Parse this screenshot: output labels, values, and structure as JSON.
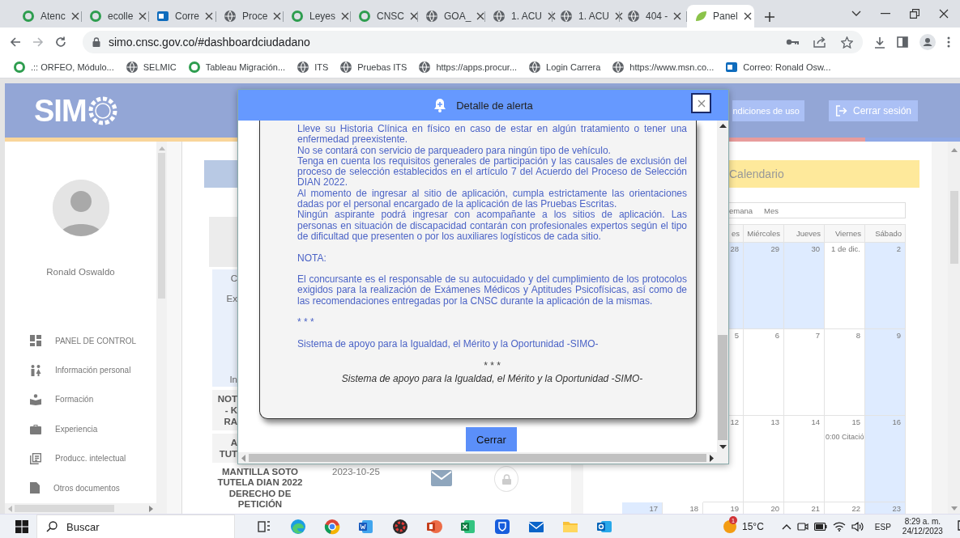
{
  "browser": {
    "tabs": [
      {
        "label": "Atenc",
        "kind": "ring",
        "selected": false
      },
      {
        "label": "ecolle",
        "kind": "ring",
        "selected": false
      },
      {
        "label": "Corre",
        "kind": "mail",
        "selected": false
      },
      {
        "label": "Proce",
        "kind": "globe",
        "selected": false
      },
      {
        "label": "Leyes",
        "kind": "ring",
        "selected": false
      },
      {
        "label": "CNSC",
        "kind": "ring",
        "selected": false
      },
      {
        "label": "GOA_",
        "kind": "globe",
        "selected": false
      },
      {
        "label": "1. ACU",
        "kind": "globe",
        "selected": false
      },
      {
        "label": "1. ACU",
        "kind": "globe",
        "selected": false
      },
      {
        "label": "404 -",
        "kind": "globe",
        "selected": false
      },
      {
        "label": "Panel",
        "kind": "leaf",
        "selected": true
      }
    ],
    "address": "simo.cnsc.gov.co/#dashboardciudadano",
    "bookmarks": [
      {
        "label": ".:: ORFEO, Módulo...",
        "kind": "ring"
      },
      {
        "label": "SELMIC",
        "kind": "globe"
      },
      {
        "label": "Tableau Migración...",
        "kind": "ring"
      },
      {
        "label": "ITS",
        "kind": "globe"
      },
      {
        "label": "Pruebas ITS",
        "kind": "globe"
      },
      {
        "label": "https://apps.procur...",
        "kind": "globe"
      },
      {
        "label": "Login Carrera",
        "kind": "globe"
      },
      {
        "label": "https://www.msn.co...",
        "kind": "globe"
      },
      {
        "label": "Correo: Ronald Osw...",
        "kind": "mail"
      }
    ]
  },
  "site": {
    "logo": "SIM",
    "header_buttons": [
      {
        "label": "ndiciones de uso",
        "kind": "plain"
      },
      {
        "label": "Cerrar sesión",
        "kind": "logout"
      }
    ],
    "sidebar": {
      "user_name": "Ronald Oswaldo",
      "items": [
        {
          "label": "PANEL DE CONTROL",
          "kind": "dashboard"
        },
        {
          "label": "Información personal",
          "kind": "people"
        },
        {
          "label": "Formación",
          "kind": "reader"
        },
        {
          "label": "Experiencia",
          "kind": "briefcase"
        },
        {
          "label": "Producc. intelectual",
          "kind": "documents"
        },
        {
          "label": "Otros documentos",
          "kind": "document"
        }
      ]
    },
    "panel": {
      "info_lines": [
        "C",
        "Ex",
        "In"
      ],
      "cut_rows": [
        {
          "lines": [
            "NOT",
            "- K",
            "RA"
          ]
        },
        {
          "lines": [
            "A",
            "TUT"
          ]
        }
      ],
      "rows": [
        {
          "title": "MANTILLA SOTO TUTELA DIAN 2022 DERECHO DE PETICIÓN",
          "date": "2023-10-25"
        }
      ]
    },
    "calendar": {
      "title": "Calendario",
      "views": [
        "emana",
        "Mes"
      ],
      "weekdays": [
        "es",
        "Miércoles",
        "Jueves",
        "Viernes",
        "Sábado"
      ],
      "weeks": [
        {
          "days": [
            {
              "label": "28",
              "shaded": true
            },
            {
              "label": "29",
              "shaded": true
            },
            {
              "label": "30",
              "shaded": true
            },
            {
              "label": "1 de dic.",
              "shaded": false
            },
            {
              "label": "2",
              "shaded": true
            }
          ]
        },
        {
          "days": [
            {
              "label": "5",
              "shaded": false
            },
            {
              "label": "6",
              "shaded": false
            },
            {
              "label": "7",
              "shaded": false
            },
            {
              "label": "8",
              "shaded": false
            },
            {
              "label": "9",
              "shaded": true
            }
          ]
        },
        {
          "days": [
            {
              "label": "12",
              "shaded": false
            },
            {
              "label": "13",
              "shaded": false
            },
            {
              "label": "14",
              "shaded": false
            },
            {
              "label": "15",
              "shaded": false,
              "event": "0:00 Citació"
            },
            {
              "label": "16",
              "shaded": true
            }
          ]
        },
        {
          "days": [
            {
              "label": "17",
              "shaded": true
            },
            {
              "label": "18",
              "shaded": false
            },
            {
              "label": "19",
              "shaded": false
            },
            {
              "label": "20",
              "shaded": false
            },
            {
              "label": "21",
              "shaded": false
            },
            {
              "label": "22",
              "shaded": false
            },
            {
              "label": "23",
              "shaded": true
            }
          ]
        }
      ]
    }
  },
  "modal": {
    "title": "Detalle de alerta",
    "blocks": [
      {
        "lines": [
          "Lleve su Historia Clínica en físico en caso de estar en algún tratamiento o tener una enfermedad preexistente.",
          "No se contará con servicio de parqueadero para ningún tipo de vehículo.",
          "Tenga en cuenta los requisitos generales de participación y las causales de exclusión del proceso de selección establecidos en el artículo 7 del Acuerdo del Proceso de Selección DIAN 2022.",
          "Al momento de ingresar al sitio de aplicación, cumpla estrictamente las orientaciones dadas por el personal encargado de la aplicación de las Pruebas Escritas.",
          "Ningún aspirante podrá ingresar con acompañante a los sitios de aplicación. Las personas en situación de discapacidad contarán con profesionales expertos según el tipo de dificultad que presenten o por los auxiliares logísticos de cada sitio."
        ]
      },
      {
        "lines": [
          "NOTA:"
        ]
      },
      {
        "lines": [
          "El concursante es el responsable de su autocuidado y del cumplimiento de los protocolos exigidos para la realización de Exámenes Médicos y Aptitudes Psicofísicas, así como de las recomendaciones entregadas por la CNSC durante la aplicación de la mismas."
        ]
      },
      {
        "lines": [
          "* * *"
        ]
      },
      {
        "lines": [
          "Sistema de apoyo para la Igualdad, el Mérito y la Oportunidad -SIMO-"
        ]
      }
    ],
    "footer_separator": "* * *",
    "footer_signature": "Sistema de apoyo para la Igualdad, el Mérito y la Oportunidad -SIMO-",
    "button": "Cerrar"
  },
  "taskbar": {
    "search_placeholder": "Buscar",
    "apps": [
      {
        "kind": "taskview"
      },
      {
        "kind": "swirl"
      },
      {
        "kind": "round"
      },
      {
        "kind": "word"
      },
      {
        "kind": "gear"
      },
      {
        "kind": "slides"
      },
      {
        "kind": "sheet"
      },
      {
        "kind": "shield"
      },
      {
        "kind": "envelope"
      },
      {
        "kind": "folder"
      },
      {
        "kind": "mailapp"
      }
    ],
    "weather": {
      "badge": "1",
      "temperature": "15°C"
    },
    "language": "ESP",
    "time": "8:29 a. m.",
    "date": "24/12/2023"
  }
}
